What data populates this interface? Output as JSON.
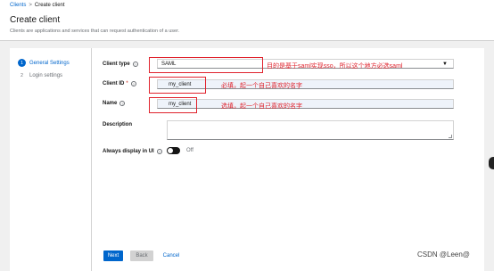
{
  "breadcrumb": {
    "items": [
      "Clients",
      "Create client"
    ],
    "separator": ">"
  },
  "page": {
    "title": "Create client",
    "description": "Clients are applications and services that can request authentication of a user."
  },
  "wizard": {
    "steps": [
      {
        "number": "1",
        "label": "General Settings",
        "active": true
      },
      {
        "number": "2",
        "label": "Login settings",
        "active": false
      }
    ]
  },
  "form": {
    "client_type": {
      "label": "Client type",
      "value": "SAML"
    },
    "client_id": {
      "label": "Client ID",
      "required_mark": "*",
      "value": "my_client"
    },
    "name": {
      "label": "Name",
      "value": "my_client"
    },
    "description": {
      "label": "Description",
      "value": ""
    },
    "always_display": {
      "label": "Always display in UI",
      "toggle_text": "Off"
    }
  },
  "buttons": {
    "next": "Next",
    "back": "Back",
    "cancel": "Cancel"
  },
  "annotations": {
    "client_type_note": "目的是基于saml实现sso，所以这个地方必选saml",
    "client_id_note": "必填，起一个自己喜欢的名字",
    "name_note": "选填，起一个自己喜欢的名字"
  },
  "icons": {
    "help": "help-circle-icon",
    "caret": "caret-down-icon"
  },
  "colors": {
    "primary": "#0066cc",
    "annotation_red": "#e0232d",
    "input_fill": "#eef3fa"
  },
  "watermark": "CSDN @Leen@"
}
